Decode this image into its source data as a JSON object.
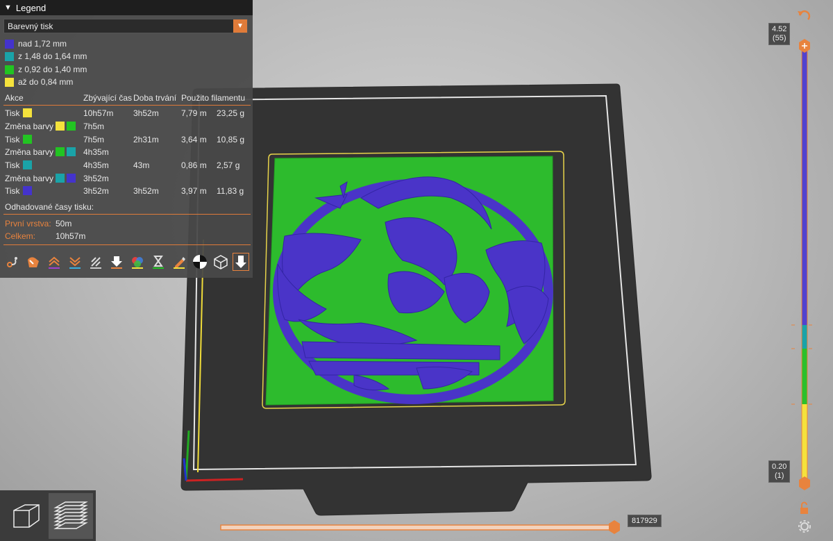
{
  "legend": {
    "title": "Legend",
    "view_select": "Barevný tisk",
    "ranges": [
      {
        "label": "nad 1,72 mm",
        "color": "#4433cc"
      },
      {
        "label": "z 1,48 do 1,64 mm",
        "color": "#1aa3a8"
      },
      {
        "label": "z 0,92 do 1,40 mm",
        "color": "#22c422"
      },
      {
        "label": "až do 0,84 mm",
        "color": "#f5e23c"
      }
    ],
    "columns": {
      "action": "Akce",
      "remaining": "Zbývající čas",
      "duration": "Doba trvání",
      "used": "Použito filamentu"
    },
    "rows": [
      {
        "action": "Tisk",
        "colors": [
          "#f5e23c"
        ],
        "remaining": "10h57m",
        "duration": "3h52m",
        "length": "7,79 m",
        "weight": "23,25 g"
      },
      {
        "action": "Změna barvy",
        "colors": [
          "#f5e23c",
          "#22c422"
        ],
        "remaining": "7h5m",
        "duration": "",
        "length": "",
        "weight": ""
      },
      {
        "action": "Tisk",
        "colors": [
          "#22c422"
        ],
        "remaining": "7h5m",
        "duration": "2h31m",
        "length": "3,64 m",
        "weight": "10,85 g"
      },
      {
        "action": "Změna barvy",
        "colors": [
          "#22c422",
          "#1aa3a8"
        ],
        "remaining": "4h35m",
        "duration": "",
        "length": "",
        "weight": ""
      },
      {
        "action": "Tisk",
        "colors": [
          "#1aa3a8"
        ],
        "remaining": "4h35m",
        "duration": "43m",
        "length": "0,86 m",
        "weight": "2,57 g"
      },
      {
        "action": "Změna barvy",
        "colors": [
          "#1aa3a8",
          "#4433cc"
        ],
        "remaining": "3h52m",
        "duration": "",
        "length": "",
        "weight": ""
      },
      {
        "action": "Tisk",
        "colors": [
          "#4433cc"
        ],
        "remaining": "3h52m",
        "duration": "3h52m",
        "length": "3,97 m",
        "weight": "11,83 g"
      }
    ],
    "estimated_title": "Odhadované časy tisku:",
    "first_layer_label": "První vrstva:",
    "first_layer_value": "50m",
    "total_label": "Celkem:",
    "total_value": "10h57m",
    "toolbar": [
      "travel-icon",
      "wipe-icon",
      "retractions-icon",
      "deretractions-icon",
      "seams-icon",
      "tool-changes-icon",
      "color-changes-icon",
      "pause-icon",
      "custom-gcode-icon",
      "center-of-gravity-icon",
      "shells-icon",
      "tool-marker-icon"
    ]
  },
  "layer_slider": {
    "top_value": "4.52",
    "top_layer": "(55)",
    "bottom_value": "0.20",
    "bottom_layer": "(1)"
  },
  "move_slider": {
    "value": "817929"
  },
  "colors": {
    "accent": "#e8833e",
    "purple": "#4433cc",
    "teal": "#1aa3a8",
    "green": "#22c422",
    "yellow": "#f5e23c"
  }
}
